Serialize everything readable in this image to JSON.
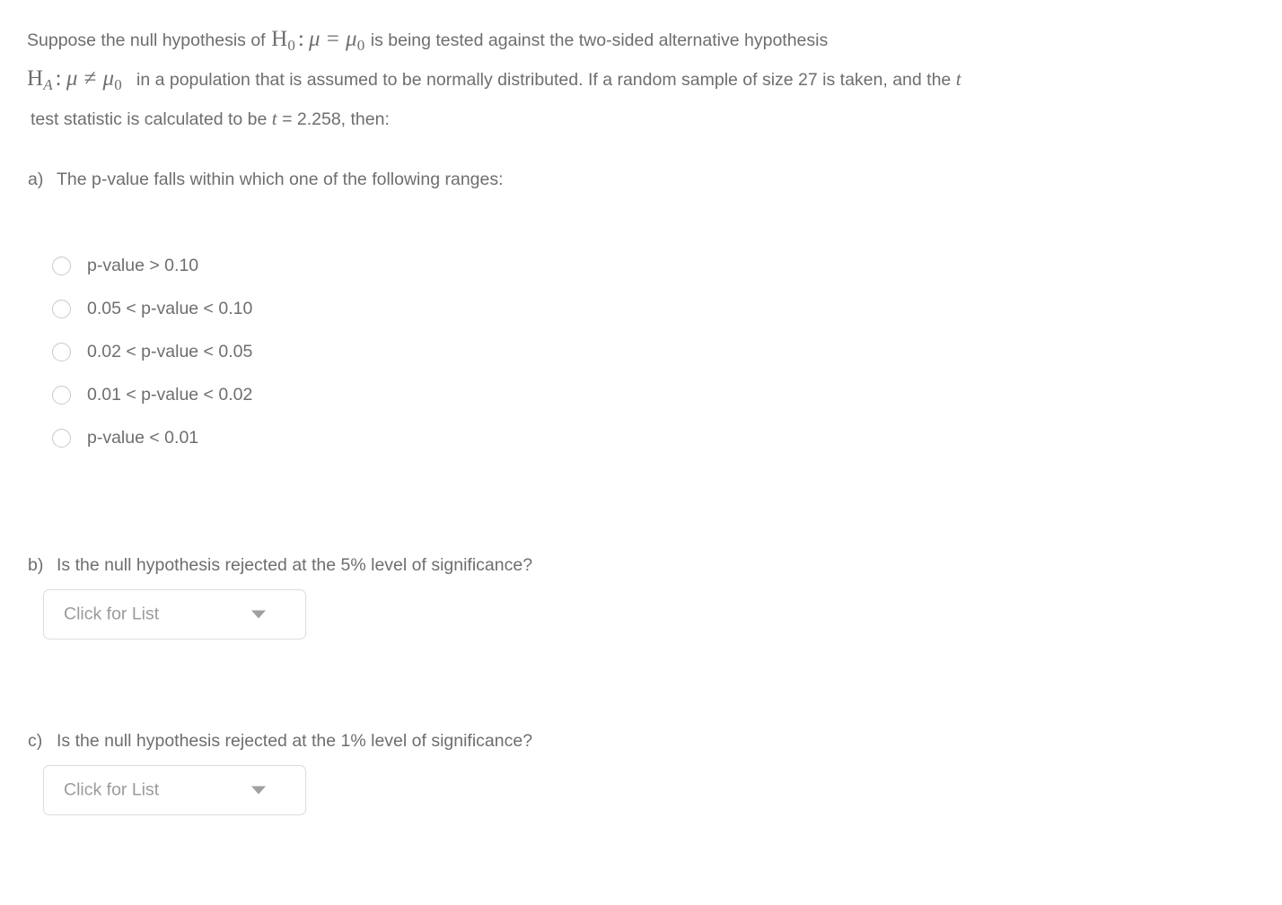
{
  "problem": {
    "line1_pre": "Suppose the null hypothesis of",
    "h0": {
      "symbol": "H",
      "subscript": "0",
      "relation": "=",
      "lhs": "μ",
      "rhs_symbol": "μ",
      "rhs_subscript": "0"
    },
    "line1_post": "is being tested against the two-sided alternative hypothesis",
    "ha": {
      "symbol": "H",
      "subscript": "A",
      "relation": "≠",
      "lhs": "μ",
      "rhs_symbol": "μ",
      "rhs_subscript": "0"
    },
    "line2_post": "in a population that is assumed to be normally distributed.  If a random sample of size 27 is taken, and the",
    "line2_trailing_italic": "t",
    "line3_pre": "test statistic is calculated to be",
    "line3_var": "t",
    "line3_eq": "= 2.258, then:"
  },
  "part_a": {
    "marker": "a)",
    "question": "The p-value falls within which one of the following ranges:",
    "options": [
      {
        "label": "p-value > 0.10",
        "selected": false
      },
      {
        "label": "0.05 < p-value < 0.10",
        "selected": false
      },
      {
        "label": "0.02 < p-value < 0.05",
        "selected": false
      },
      {
        "label": "0.01 < p-value < 0.02",
        "selected": false
      },
      {
        "label": "p-value < 0.01",
        "selected": false
      }
    ]
  },
  "part_b": {
    "marker": "b)",
    "question": "Is the null hypothesis rejected at the 5% level of significance?",
    "dropdown": {
      "value": "Click for List",
      "icon": "chevron-down-icon"
    }
  },
  "part_c": {
    "marker": "c)",
    "question": "Is the null hypothesis rejected at the 1% level of significance?",
    "dropdown": {
      "value": "Click for List",
      "icon": "chevron-down-icon"
    }
  },
  "colors": {
    "text": "#6e6e6e",
    "placeholder": "#9b9b9b",
    "border": "#dcdcdc",
    "radio_border": "#cacaca",
    "background": "#ffffff"
  }
}
